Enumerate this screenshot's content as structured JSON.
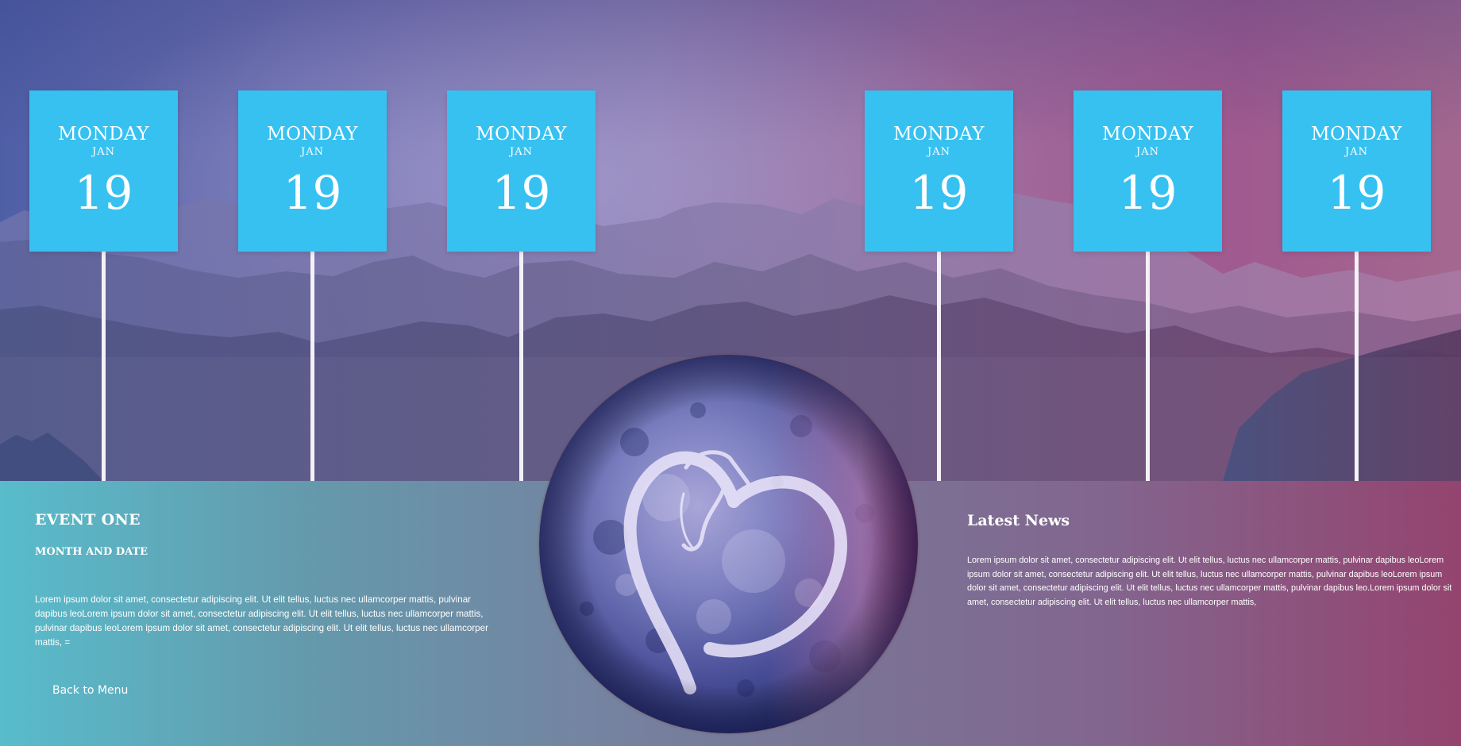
{
  "calendar": {
    "cards": [
      {
        "day": "MONDAY",
        "month": "JAN",
        "date": "19"
      },
      {
        "day": "MONDAY",
        "month": "JAN",
        "date": "19"
      },
      {
        "day": "MONDAY",
        "month": "JAN",
        "date": "19"
      },
      {
        "day": "MONDAY",
        "month": "JAN",
        "date": "19"
      },
      {
        "day": "MONDAY",
        "month": "JAN",
        "date": "19"
      },
      {
        "day": "MONDAY",
        "month": "JAN",
        "date": "19"
      }
    ]
  },
  "event": {
    "title": "EVENT ONE",
    "subtitle": "MONTH AND DATE",
    "body": "Lorem ipsum dolor sit amet, consectetur adipiscing elit. Ut elit tellus, luctus nec ullamcorper mattis, pulvinar dapibus leoLorem ipsum dolor sit amet, consectetur adipiscing elit. Ut elit tellus, luctus nec ullamcorper mattis, pulvinar dapibus leoLorem ipsum dolor sit amet, consectetur adipiscing elit. Ut elit tellus, luctus nec ullamcorper mattis, ="
  },
  "navigation": {
    "back_label": "Back to Menu"
  },
  "news": {
    "title": "Latest News",
    "body": "Lorem ipsum dolor sit amet, consectetur adipiscing elit. Ut elit tellus, luctus nec ullamcorper mattis, pulvinar dapibus leoLorem ipsum dolor sit amet, consectetur adipiscing elit. Ut elit tellus, luctus nec ullamcorper mattis, pulvinar dapibus leoLorem ipsum dolor sit amet, consectetur adipiscing elit. Ut elit tellus, luctus nec ullamcorper mattis, pulvinar dapibus leo.Lorem ipsum dolor sit amet, consectetur adipiscing elit. Ut elit tellus, luctus nec ullamcorper mattis,"
  },
  "colors": {
    "card_blue": "#37c1f1",
    "text_white": "#ffffff",
    "pole_white": "#f4f2f6"
  },
  "icons": {
    "planet": "planet-heart-horse-emblem"
  }
}
